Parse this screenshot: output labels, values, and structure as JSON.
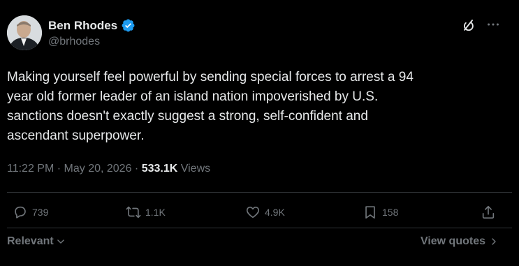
{
  "author": {
    "name": "Ben Rhodes",
    "handle": "@brhodes"
  },
  "tweet": {
    "text": "Making yourself feel powerful by sending special forces to arrest a 94\nyear old former leader of an island nation impoverished by U.S.\nsanctions doesn't exactly suggest a strong, self-confident and\nascendant superpower.",
    "time": "11:22 PM",
    "separator": " · ",
    "date": "May 20, 2026",
    "views_count": "533.1K",
    "views_label": " Views"
  },
  "actions": {
    "replies": "739",
    "reposts": "1.1K",
    "likes": "4.9K",
    "bookmarks": "158"
  },
  "footer": {
    "sort_label": "Relevant",
    "view_quotes": "View quotes"
  },
  "colors": {
    "background": "#000000",
    "text": "#e7e9ea",
    "secondary": "#71767b",
    "verified": "#1d9bf0",
    "divider": "#2f3336"
  },
  "icons": [
    "verified-badge-icon",
    "grok-icon",
    "more-icon",
    "reply-icon",
    "repost-icon",
    "like-icon",
    "bookmark-icon",
    "share-icon",
    "chevron-down-icon",
    "chevron-right-icon"
  ]
}
